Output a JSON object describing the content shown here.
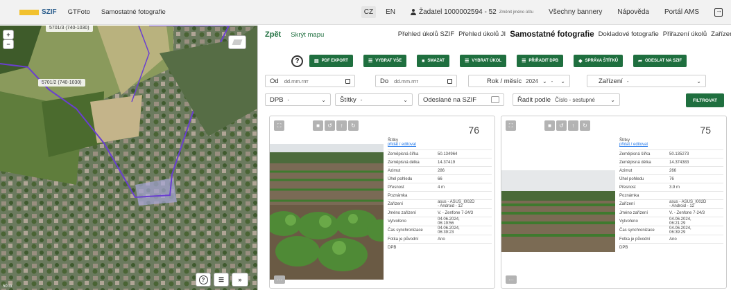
{
  "topbar": {
    "logo": "SZIF",
    "app": "GTFoto",
    "section": "Samostatné fotografie",
    "lang_cz": "CZ",
    "lang_en": "EN",
    "user": "Žadatel 1000002594 - 52",
    "user_small": "Změnit jméno účtu",
    "banners": "Všechny bannery",
    "help": "Nápověda",
    "portal": "Portál AMS"
  },
  "map": {
    "label_top": "5701/3 (740-1030)",
    "label_mid": "5701/2 (740-1030)",
    "zoom_in": "+",
    "zoom_out": "−",
    "scale": "50 m",
    "btn_help": "?",
    "btn_list": "☰",
    "btn_more": "»"
  },
  "nav": {
    "back": "Zpět",
    "hide_map": "Skrýt mapu",
    "items": [
      "Přehled úkolů SZIF",
      "Přehled úkolů JI",
      "Samostatné fotografie",
      "Dokladové fotografie",
      "Přiřazení úkolů",
      "Zařízení"
    ]
  },
  "toolbar": {
    "help": "?",
    "pdf": "PDF EXPORT",
    "select_all": "VYBRAT VŠE",
    "delete": "SMAZAT",
    "select_task": "VYBRAT ÚKOL",
    "assign_dpb": "PŘIŘADIT DPB",
    "tags": "SPRÁVA ŠTÍTKŮ",
    "send": "ODESLAT NA SZIF"
  },
  "filters": {
    "from_label": "Od",
    "from_ph": "dd.mm.rrrr",
    "to_label": "Do",
    "to_ph": "dd.mm.rrrr",
    "year_label": "Rok / měsíc",
    "year": "2024",
    "month": "-",
    "device_label": "Zařízení",
    "device": "-",
    "dpb_label": "DPB",
    "dpb": "-",
    "tags_label": "Štítky",
    "tags": "-",
    "sent_label": "Odeslané na SZIF",
    "sort_label": "Řadit podle",
    "sort": "Číslo - sestupné",
    "filter_btn": "FILTROVAT"
  },
  "cards": [
    {
      "number": "76",
      "tags_title": "Štítky",
      "tags_link": "přidat / editovat",
      "rows": [
        {
          "k": "Zeměpisná šířka",
          "v": "50.134964"
        },
        {
          "k": "Zeměpisná délka",
          "v": "14.37419"
        },
        {
          "k": "Azimut",
          "v": "286"
        },
        {
          "k": "Úhel pohledu",
          "v": "66"
        },
        {
          "k": "Přesnost",
          "v": "4 m"
        },
        {
          "k": "Poznámka",
          "v": ""
        },
        {
          "k": "Zařízení",
          "v": "asus - ASUS_I002D - Android - 12"
        },
        {
          "k": "Jméno zařízení",
          "v": "V. - Zenfone 7-24/3"
        },
        {
          "k": "Vytvořeno",
          "v": "04.06.2024, 06:19:56"
        },
        {
          "k": "Čas synchronizace",
          "v": "04.06.2024, 06:39:23"
        },
        {
          "k": "Fotka je původní",
          "v": "Ano"
        },
        {
          "k": "DPB",
          "v": ""
        }
      ]
    },
    {
      "number": "75",
      "tags_title": "Štítky",
      "tags_link": "přidat / editovat",
      "rows": [
        {
          "k": "Zeměpisná šířka",
          "v": "50.135273"
        },
        {
          "k": "Zeměpisná délka",
          "v": "14.374383"
        },
        {
          "k": "Azimut",
          "v": "266"
        },
        {
          "k": "Úhel pohledu",
          "v": "76"
        },
        {
          "k": "Přesnost",
          "v": "3.9 m"
        },
        {
          "k": "Poznámka",
          "v": ""
        },
        {
          "k": "Zařízení",
          "v": "asus - ASUS_I002D - Android - 12"
        },
        {
          "k": "Jméno zařízení",
          "v": "V. - Zenfone 7-24/3"
        },
        {
          "k": "Vytvořeno",
          "v": "04.06.2024, 06:21:29"
        },
        {
          "k": "Čas synchronizace",
          "v": "04.06.2024, 06:39:29"
        },
        {
          "k": "Fotka je původní",
          "v": "Ano"
        },
        {
          "k": "DPB",
          "v": ""
        }
      ]
    }
  ]
}
